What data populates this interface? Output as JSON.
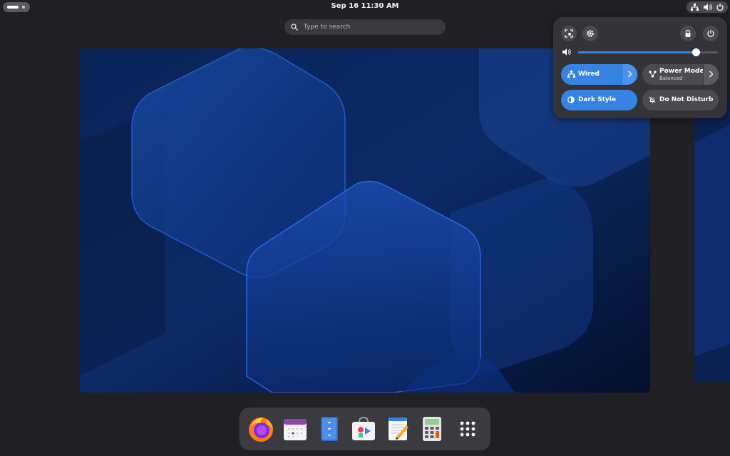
{
  "topbar": {
    "clock": "Sep 16  11:30 AM"
  },
  "search": {
    "placeholder": "Type to search"
  },
  "dock": {
    "items": [
      {
        "name": "firefox-icon"
      },
      {
        "name": "calendar-icon"
      },
      {
        "name": "files-icon"
      },
      {
        "name": "software-icon"
      },
      {
        "name": "text-editor-icon"
      },
      {
        "name": "calculator-icon"
      },
      {
        "name": "app-grid-icon"
      }
    ]
  },
  "quick_settings": {
    "volume_level": 0.84,
    "tiles": {
      "wired": {
        "label": "Wired",
        "active": true
      },
      "power_mode": {
        "label": "Power Mode",
        "subtitle": "Balanced",
        "active": false
      },
      "dark_style": {
        "label": "Dark Style",
        "active": true
      },
      "do_not_disturb": {
        "label": "Do Not Disturb",
        "active": false
      }
    }
  },
  "colors": {
    "accent": "#3584e4",
    "panel": "#343438",
    "background": "#202024"
  }
}
